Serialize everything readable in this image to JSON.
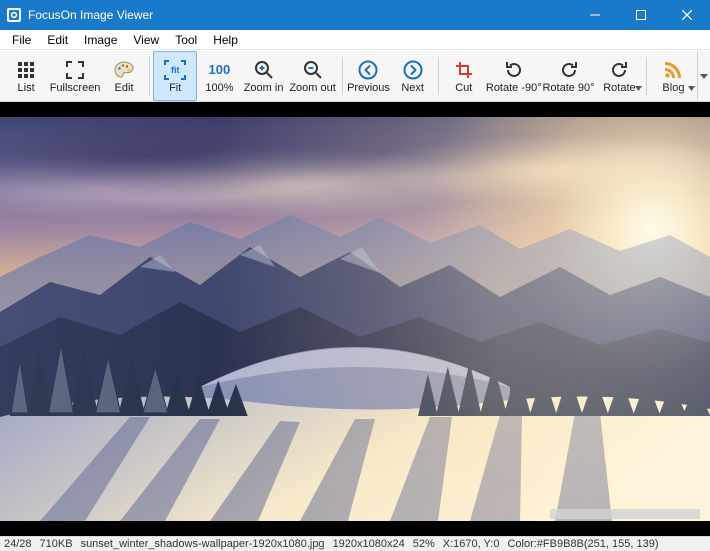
{
  "titlebar": {
    "title": "FocusOn Image Viewer"
  },
  "menu": {
    "file": "File",
    "edit": "Edit",
    "image": "Image",
    "view": "View",
    "tool": "Tool",
    "help": "Help"
  },
  "toolbar": {
    "list": "List",
    "fullscreen": "Fullscreen",
    "edit": "Edit",
    "fit": "Fit",
    "hundred": "100%",
    "hundred_icon": "100",
    "fit_icon": "fit",
    "zoom_in": "Zoom in",
    "zoom_out": "Zoom out",
    "previous": "Previous",
    "next": "Next",
    "cut": "Cut",
    "rotate_neg90": "Rotate -90°",
    "rotate_90": "Rotate 90°",
    "rotate": "Rotate",
    "blog": "Blog"
  },
  "status": {
    "index": "24/28",
    "size": "710KB",
    "filename": "sunset_winter_shadows-wallpaper-1920x1080.jpg",
    "dimensions": "1920x1080x24",
    "zoom": "52%",
    "coords": "X:1670, Y:0",
    "color": "Color:#FB9B8B(251, 155, 139)"
  },
  "colors": {
    "brand": "#1979ca",
    "toolbar_active": "#cfe8ff",
    "icon_blue": "#1a6fc0",
    "icon_red": "#d43f2a",
    "icon_orange": "#e69a21"
  }
}
